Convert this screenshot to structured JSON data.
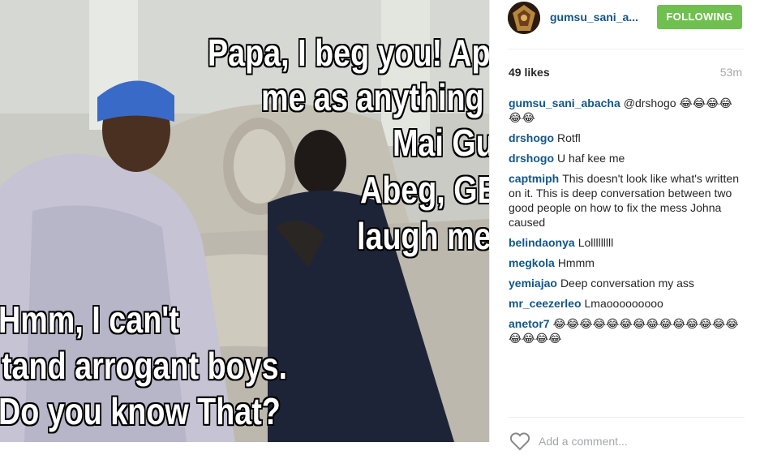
{
  "photo": {
    "meme_lines_right": [
      "Papa, I beg you! Appo",
      "me as anything e",
      "Mai Gua",
      "Abeg, GEJ",
      "laugh me"
    ],
    "meme_lines_left": [
      "Hmm, I can't",
      "tand arrogant boys.",
      "Do you know That?"
    ]
  },
  "header": {
    "username": "gumsu_sani_a...",
    "follow_label": "FOLLOWING",
    "follow_color": "#70c050"
  },
  "stats": {
    "likes": "49 likes",
    "time": "53m"
  },
  "comments": [
    {
      "author": "gumsu_sani_abacha",
      "text": "@drshogo 😂😂😂😂😂😂"
    },
    {
      "author": "drshogo",
      "text": "Rotfl"
    },
    {
      "author": "drshogo",
      "text": "U haf kee me"
    },
    {
      "author": "captmiph",
      "text": "This doesn't look like what's written on it. This is deep conversation between two good people on how to fix the mess Johna caused"
    },
    {
      "author": "belindaonya",
      "text": "Lolllllllll"
    },
    {
      "author": "megkola",
      "text": "Hmmm"
    },
    {
      "author": "yemiajao",
      "text": "Deep conversation my ass"
    },
    {
      "author": "mr_ceezerleo",
      "text": "Lmaooooooooo"
    },
    {
      "author": "anetor7",
      "text": "😂😂😂😂😂😂😂😂😂😂😂😂😂😂😂😂😂😂"
    }
  ],
  "footer": {
    "add_comment_placeholder": "Add a comment..."
  },
  "colors": {
    "link": "#125688",
    "muted": "#a5a7aa"
  }
}
